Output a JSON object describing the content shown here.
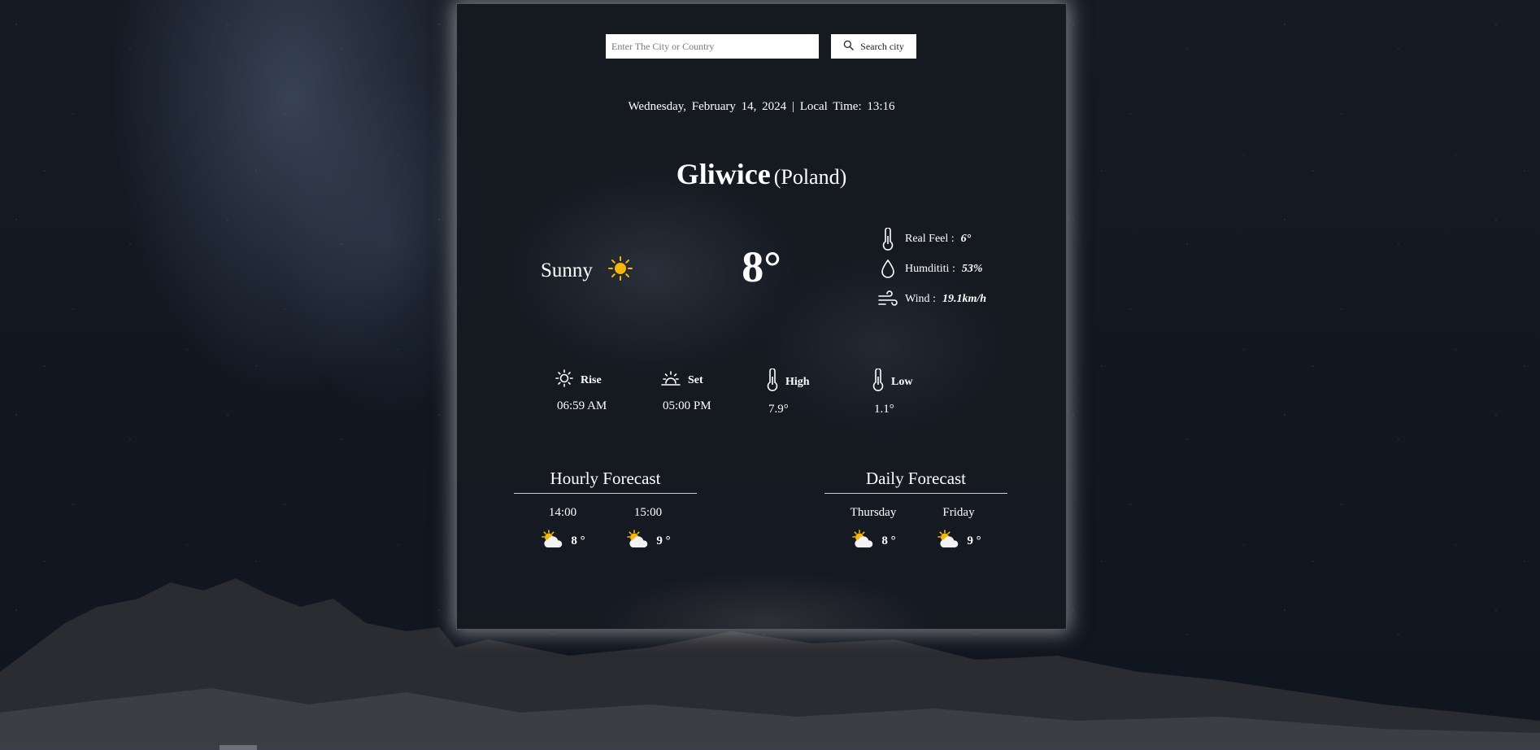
{
  "search": {
    "placeholder": "Enter The City or Country",
    "button_label": "Search city",
    "button_icon": "search-icon"
  },
  "header": {
    "date": "Wednesday, February 14, 2024",
    "separator": "|",
    "local_time_label": "Local Time:",
    "local_time": "13:16"
  },
  "location": {
    "city": "Gliwice",
    "country": "(Poland)"
  },
  "current": {
    "condition": "Sunny",
    "condition_icon": "sun-icon",
    "temperature": "8°",
    "details": [
      {
        "icon": "thermometer-icon",
        "label": "Real Feel :",
        "value": "6°"
      },
      {
        "icon": "droplet-icon",
        "label": "Humdititi :",
        "value": "53%"
      },
      {
        "icon": "wind-icon",
        "label": "Wind :",
        "value": "19.1km/h"
      }
    ]
  },
  "stats": [
    {
      "icon": "sunrise-icon",
      "label": "Rise",
      "value": "06:59 AM"
    },
    {
      "icon": "sunset-icon",
      "label": "Set",
      "value": "05:00 PM"
    },
    {
      "icon": "thermometer-icon",
      "label": "High",
      "value": "7.9°"
    },
    {
      "icon": "thermometer-icon",
      "label": "Low",
      "value": "1.1°"
    }
  ],
  "hourly": {
    "title": "Hourly Forecast",
    "items": [
      {
        "label": "14:00",
        "icon": "partly-cloudy-icon",
        "temp": "8 °"
      },
      {
        "label": "15:00",
        "icon": "partly-cloudy-icon",
        "temp": "9 °"
      }
    ]
  },
  "daily": {
    "title": "Daily Forecast",
    "items": [
      {
        "label": "Thursday",
        "icon": "partly-cloudy-icon",
        "temp": "8 °"
      },
      {
        "label": "Friday",
        "icon": "partly-cloudy-icon",
        "temp": "9 °"
      }
    ]
  },
  "colors": {
    "sun": "#f5b60d",
    "cloud": "#f2f2f2",
    "text": "#ffffff",
    "card_bg": "#161a21"
  }
}
